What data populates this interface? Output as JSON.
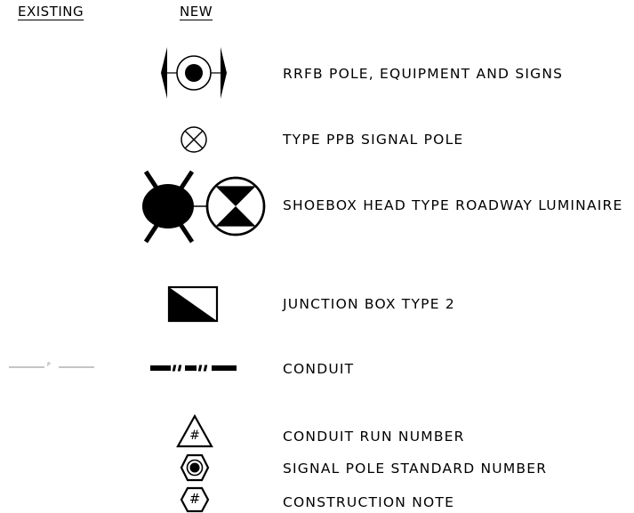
{
  "headers": {
    "existing": "EXISTING",
    "new": "NEW"
  },
  "existing_conduit_letter": "P",
  "legend": [
    {
      "label": "RRFB POLE, EQUIPMENT AND SIGNS",
      "icon": "rrfb-pole-icon"
    },
    {
      "label": "TYPE PPB SIGNAL POLE",
      "icon": "ppb-signal-pole-icon"
    },
    {
      "label": "SHOEBOX HEAD TYPE ROADWAY LUMINAIRE",
      "icon": "shoebox-luminaire-icon"
    },
    {
      "label": "JUNCTION BOX TYPE 2",
      "icon": "junction-box-icon"
    },
    {
      "label": "CONDUIT",
      "icon": "conduit-icon"
    },
    {
      "label": "CONDUIT RUN NUMBER",
      "icon": "conduit-run-number-icon",
      "symbol_text": "#"
    },
    {
      "label": "SIGNAL POLE STANDARD NUMBER",
      "icon": "signal-pole-standard-number-icon"
    },
    {
      "label": "CONSTRUCTION NOTE",
      "icon": "construction-note-icon",
      "symbol_text": "#"
    }
  ],
  "colors": {
    "ink": "#000000",
    "existing_line": "#8a8a8a"
  }
}
